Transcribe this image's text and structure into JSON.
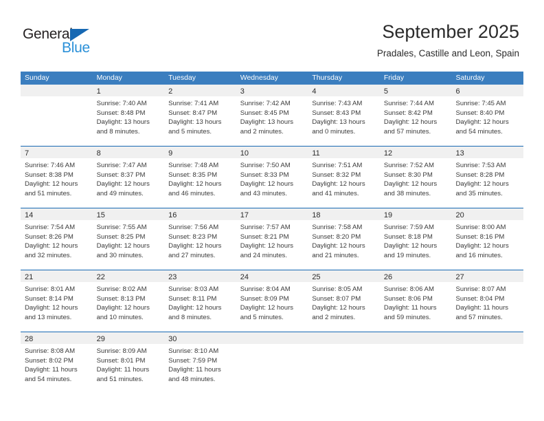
{
  "brand": {
    "name_part1": "General",
    "name_part2": "Blue",
    "triangle_icon": "triangle-icon",
    "color_dark": "#231f20",
    "color_blue": "#2a90d8",
    "color_triangle": "#1668b3"
  },
  "header": {
    "month_title": "September 2025",
    "location": "Pradales, Castille and Leon, Spain",
    "header_bg": "#3b7ebf",
    "separator_color": "#1668b3",
    "date_band_bg": "#f0f0f0"
  },
  "weekdays": [
    "Sunday",
    "Monday",
    "Tuesday",
    "Wednesday",
    "Thursday",
    "Friday",
    "Saturday"
  ],
  "weeks": [
    {
      "days": [
        {
          "date": "",
          "empty": true,
          "lines": []
        },
        {
          "date": "1",
          "empty": false,
          "lines": [
            "Sunrise: 7:40 AM",
            "Sunset: 8:48 PM",
            "Daylight: 13 hours",
            "and 8 minutes."
          ]
        },
        {
          "date": "2",
          "empty": false,
          "lines": [
            "Sunrise: 7:41 AM",
            "Sunset: 8:47 PM",
            "Daylight: 13 hours",
            "and 5 minutes."
          ]
        },
        {
          "date": "3",
          "empty": false,
          "lines": [
            "Sunrise: 7:42 AM",
            "Sunset: 8:45 PM",
            "Daylight: 13 hours",
            "and 2 minutes."
          ]
        },
        {
          "date": "4",
          "empty": false,
          "lines": [
            "Sunrise: 7:43 AM",
            "Sunset: 8:43 PM",
            "Daylight: 13 hours",
            "and 0 minutes."
          ]
        },
        {
          "date": "5",
          "empty": false,
          "lines": [
            "Sunrise: 7:44 AM",
            "Sunset: 8:42 PM",
            "Daylight: 12 hours",
            "and 57 minutes."
          ]
        },
        {
          "date": "6",
          "empty": false,
          "lines": [
            "Sunrise: 7:45 AM",
            "Sunset: 8:40 PM",
            "Daylight: 12 hours",
            "and 54 minutes."
          ]
        }
      ]
    },
    {
      "days": [
        {
          "date": "7",
          "empty": false,
          "lines": [
            "Sunrise: 7:46 AM",
            "Sunset: 8:38 PM",
            "Daylight: 12 hours",
            "and 51 minutes."
          ]
        },
        {
          "date": "8",
          "empty": false,
          "lines": [
            "Sunrise: 7:47 AM",
            "Sunset: 8:37 PM",
            "Daylight: 12 hours",
            "and 49 minutes."
          ]
        },
        {
          "date": "9",
          "empty": false,
          "lines": [
            "Sunrise: 7:48 AM",
            "Sunset: 8:35 PM",
            "Daylight: 12 hours",
            "and 46 minutes."
          ]
        },
        {
          "date": "10",
          "empty": false,
          "lines": [
            "Sunrise: 7:50 AM",
            "Sunset: 8:33 PM",
            "Daylight: 12 hours",
            "and 43 minutes."
          ]
        },
        {
          "date": "11",
          "empty": false,
          "lines": [
            "Sunrise: 7:51 AM",
            "Sunset: 8:32 PM",
            "Daylight: 12 hours",
            "and 41 minutes."
          ]
        },
        {
          "date": "12",
          "empty": false,
          "lines": [
            "Sunrise: 7:52 AM",
            "Sunset: 8:30 PM",
            "Daylight: 12 hours",
            "and 38 minutes."
          ]
        },
        {
          "date": "13",
          "empty": false,
          "lines": [
            "Sunrise: 7:53 AM",
            "Sunset: 8:28 PM",
            "Daylight: 12 hours",
            "and 35 minutes."
          ]
        }
      ]
    },
    {
      "days": [
        {
          "date": "14",
          "empty": false,
          "lines": [
            "Sunrise: 7:54 AM",
            "Sunset: 8:26 PM",
            "Daylight: 12 hours",
            "and 32 minutes."
          ]
        },
        {
          "date": "15",
          "empty": false,
          "lines": [
            "Sunrise: 7:55 AM",
            "Sunset: 8:25 PM",
            "Daylight: 12 hours",
            "and 30 minutes."
          ]
        },
        {
          "date": "16",
          "empty": false,
          "lines": [
            "Sunrise: 7:56 AM",
            "Sunset: 8:23 PM",
            "Daylight: 12 hours",
            "and 27 minutes."
          ]
        },
        {
          "date": "17",
          "empty": false,
          "lines": [
            "Sunrise: 7:57 AM",
            "Sunset: 8:21 PM",
            "Daylight: 12 hours",
            "and 24 minutes."
          ]
        },
        {
          "date": "18",
          "empty": false,
          "lines": [
            "Sunrise: 7:58 AM",
            "Sunset: 8:20 PM",
            "Daylight: 12 hours",
            "and 21 minutes."
          ]
        },
        {
          "date": "19",
          "empty": false,
          "lines": [
            "Sunrise: 7:59 AM",
            "Sunset: 8:18 PM",
            "Daylight: 12 hours",
            "and 19 minutes."
          ]
        },
        {
          "date": "20",
          "empty": false,
          "lines": [
            "Sunrise: 8:00 AM",
            "Sunset: 8:16 PM",
            "Daylight: 12 hours",
            "and 16 minutes."
          ]
        }
      ]
    },
    {
      "days": [
        {
          "date": "21",
          "empty": false,
          "lines": [
            "Sunrise: 8:01 AM",
            "Sunset: 8:14 PM",
            "Daylight: 12 hours",
            "and 13 minutes."
          ]
        },
        {
          "date": "22",
          "empty": false,
          "lines": [
            "Sunrise: 8:02 AM",
            "Sunset: 8:13 PM",
            "Daylight: 12 hours",
            "and 10 minutes."
          ]
        },
        {
          "date": "23",
          "empty": false,
          "lines": [
            "Sunrise: 8:03 AM",
            "Sunset: 8:11 PM",
            "Daylight: 12 hours",
            "and 8 minutes."
          ]
        },
        {
          "date": "24",
          "empty": false,
          "lines": [
            "Sunrise: 8:04 AM",
            "Sunset: 8:09 PM",
            "Daylight: 12 hours",
            "and 5 minutes."
          ]
        },
        {
          "date": "25",
          "empty": false,
          "lines": [
            "Sunrise: 8:05 AM",
            "Sunset: 8:07 PM",
            "Daylight: 12 hours",
            "and 2 minutes."
          ]
        },
        {
          "date": "26",
          "empty": false,
          "lines": [
            "Sunrise: 8:06 AM",
            "Sunset: 8:06 PM",
            "Daylight: 11 hours",
            "and 59 minutes."
          ]
        },
        {
          "date": "27",
          "empty": false,
          "lines": [
            "Sunrise: 8:07 AM",
            "Sunset: 8:04 PM",
            "Daylight: 11 hours",
            "and 57 minutes."
          ]
        }
      ]
    },
    {
      "days": [
        {
          "date": "28",
          "empty": false,
          "lines": [
            "Sunrise: 8:08 AM",
            "Sunset: 8:02 PM",
            "Daylight: 11 hours",
            "and 54 minutes."
          ]
        },
        {
          "date": "29",
          "empty": false,
          "lines": [
            "Sunrise: 8:09 AM",
            "Sunset: 8:01 PM",
            "Daylight: 11 hours",
            "and 51 minutes."
          ]
        },
        {
          "date": "30",
          "empty": false,
          "lines": [
            "Sunrise: 8:10 AM",
            "Sunset: 7:59 PM",
            "Daylight: 11 hours",
            "and 48 minutes."
          ]
        },
        {
          "date": "",
          "empty": true,
          "lines": []
        },
        {
          "date": "",
          "empty": true,
          "lines": []
        },
        {
          "date": "",
          "empty": true,
          "lines": []
        },
        {
          "date": "",
          "empty": true,
          "lines": []
        }
      ]
    }
  ]
}
